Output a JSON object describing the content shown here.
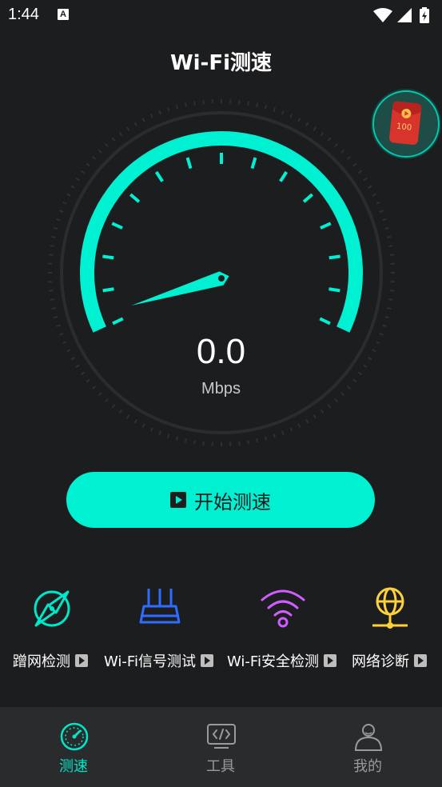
{
  "status_bar": {
    "time": "1:44",
    "notification_badge": "A"
  },
  "header": {
    "title": "Wi-Fi测速"
  },
  "gauge": {
    "speed_value": "0.0",
    "unit": "Mbps",
    "accent_color": "#00f0d2"
  },
  "start_button": {
    "label": "开始测速"
  },
  "tools": [
    {
      "label": "蹭网检测",
      "icon": "compass-icon",
      "color": "#00e6c8"
    },
    {
      "label": "Wi-Fi信号测试",
      "icon": "router-icon",
      "color": "#2f6cff"
    },
    {
      "label": "Wi-Fi安全检测",
      "icon": "wifi-icon",
      "color": "#d15cff"
    },
    {
      "label": "网络诊断",
      "icon": "globe-network-icon",
      "color": "#ffd23a"
    }
  ],
  "promo": {
    "icon": "red-envelope-icon",
    "amount": "100"
  },
  "tab_bar": {
    "tabs": [
      {
        "label": "测速",
        "icon": "speedometer-icon",
        "active": true
      },
      {
        "label": "工具",
        "icon": "code-monitor-icon",
        "active": false
      },
      {
        "label": "我的",
        "icon": "user-icon",
        "active": false
      }
    ]
  }
}
